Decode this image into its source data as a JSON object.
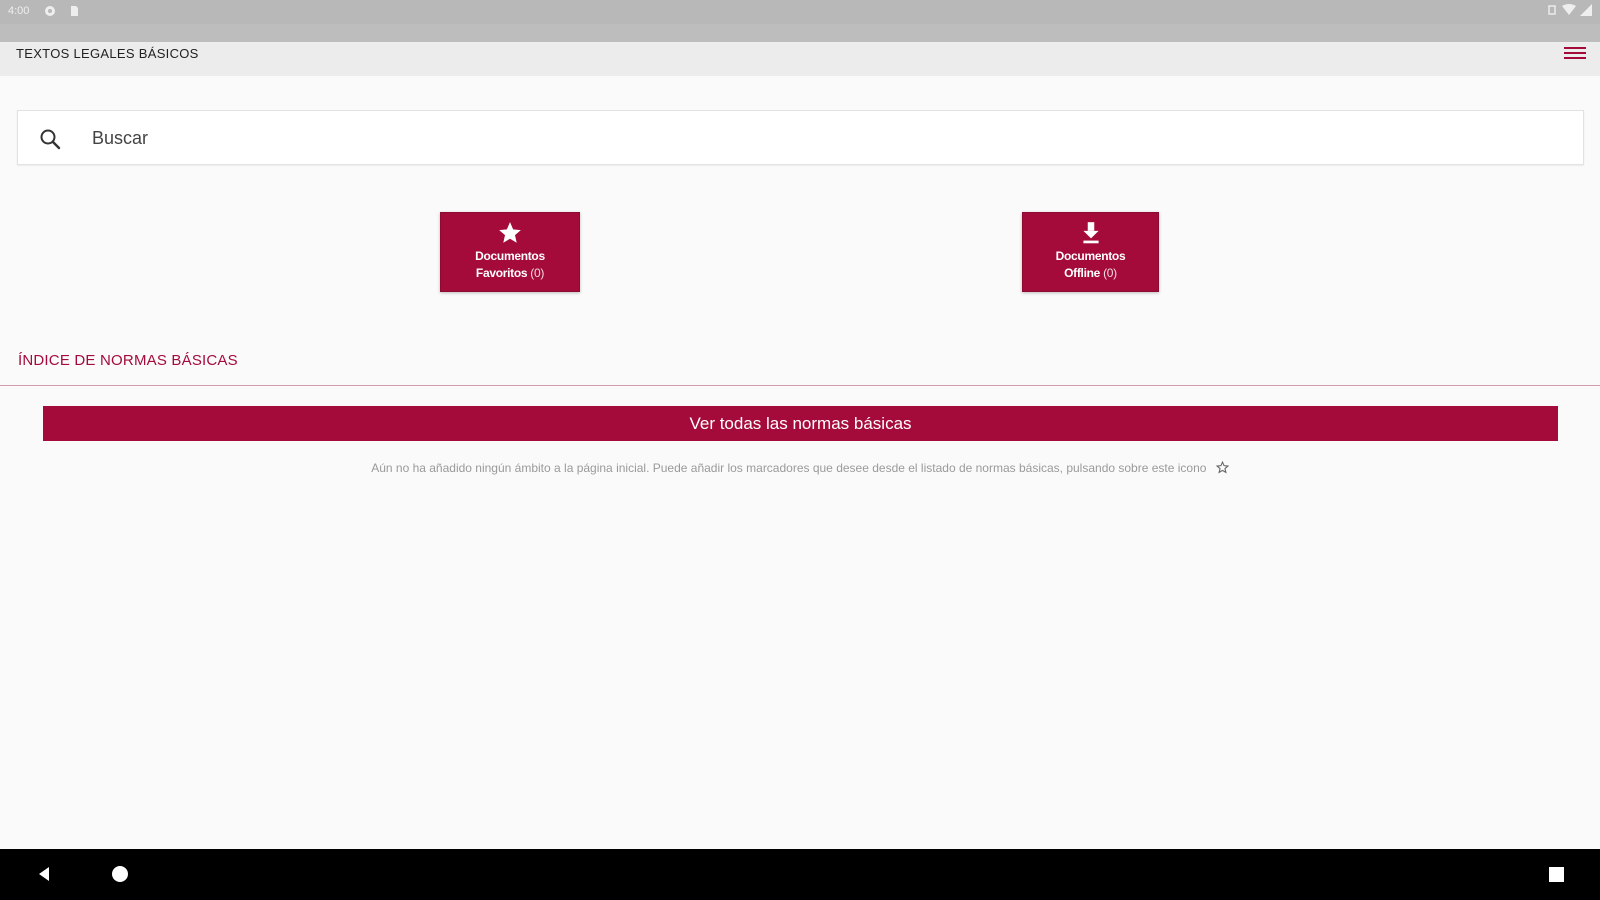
{
  "status_bar": {
    "time": "4:00",
    "left_icons": [
      "settings-icon",
      "sd-card-icon"
    ],
    "right_icons": [
      "vibrate-icon",
      "wifi-icon",
      "signal-icon"
    ]
  },
  "app_bar": {
    "title": "TEXTOS LEGALES BÁSICOS",
    "menu_icon": "hamburger-menu-icon",
    "accent_color": "#a50b3a"
  },
  "search": {
    "placeholder": "Buscar",
    "value": "",
    "icon": "search-icon"
  },
  "tiles": [
    {
      "icon": "star-icon",
      "line1": "Documentos",
      "line2": "Favoritos",
      "count": "(0)"
    },
    {
      "icon": "download-icon",
      "line1": "Documentos",
      "line2": "Offline",
      "count": "(0)"
    }
  ],
  "index": {
    "title": "ÍNDICE DE NORMAS BÁSICAS",
    "button_label": "Ver todas las normas básicas",
    "info_text": "Aún no ha añadido ningún ámbito a la página inicial. Puede añadir los marcadores que desee desde el listado de normas básicas, pulsando sobre este icono",
    "info_icon": "star-outline-icon"
  },
  "nav_bar": {
    "icons": [
      "back-icon",
      "home-icon",
      "recents-icon"
    ]
  }
}
